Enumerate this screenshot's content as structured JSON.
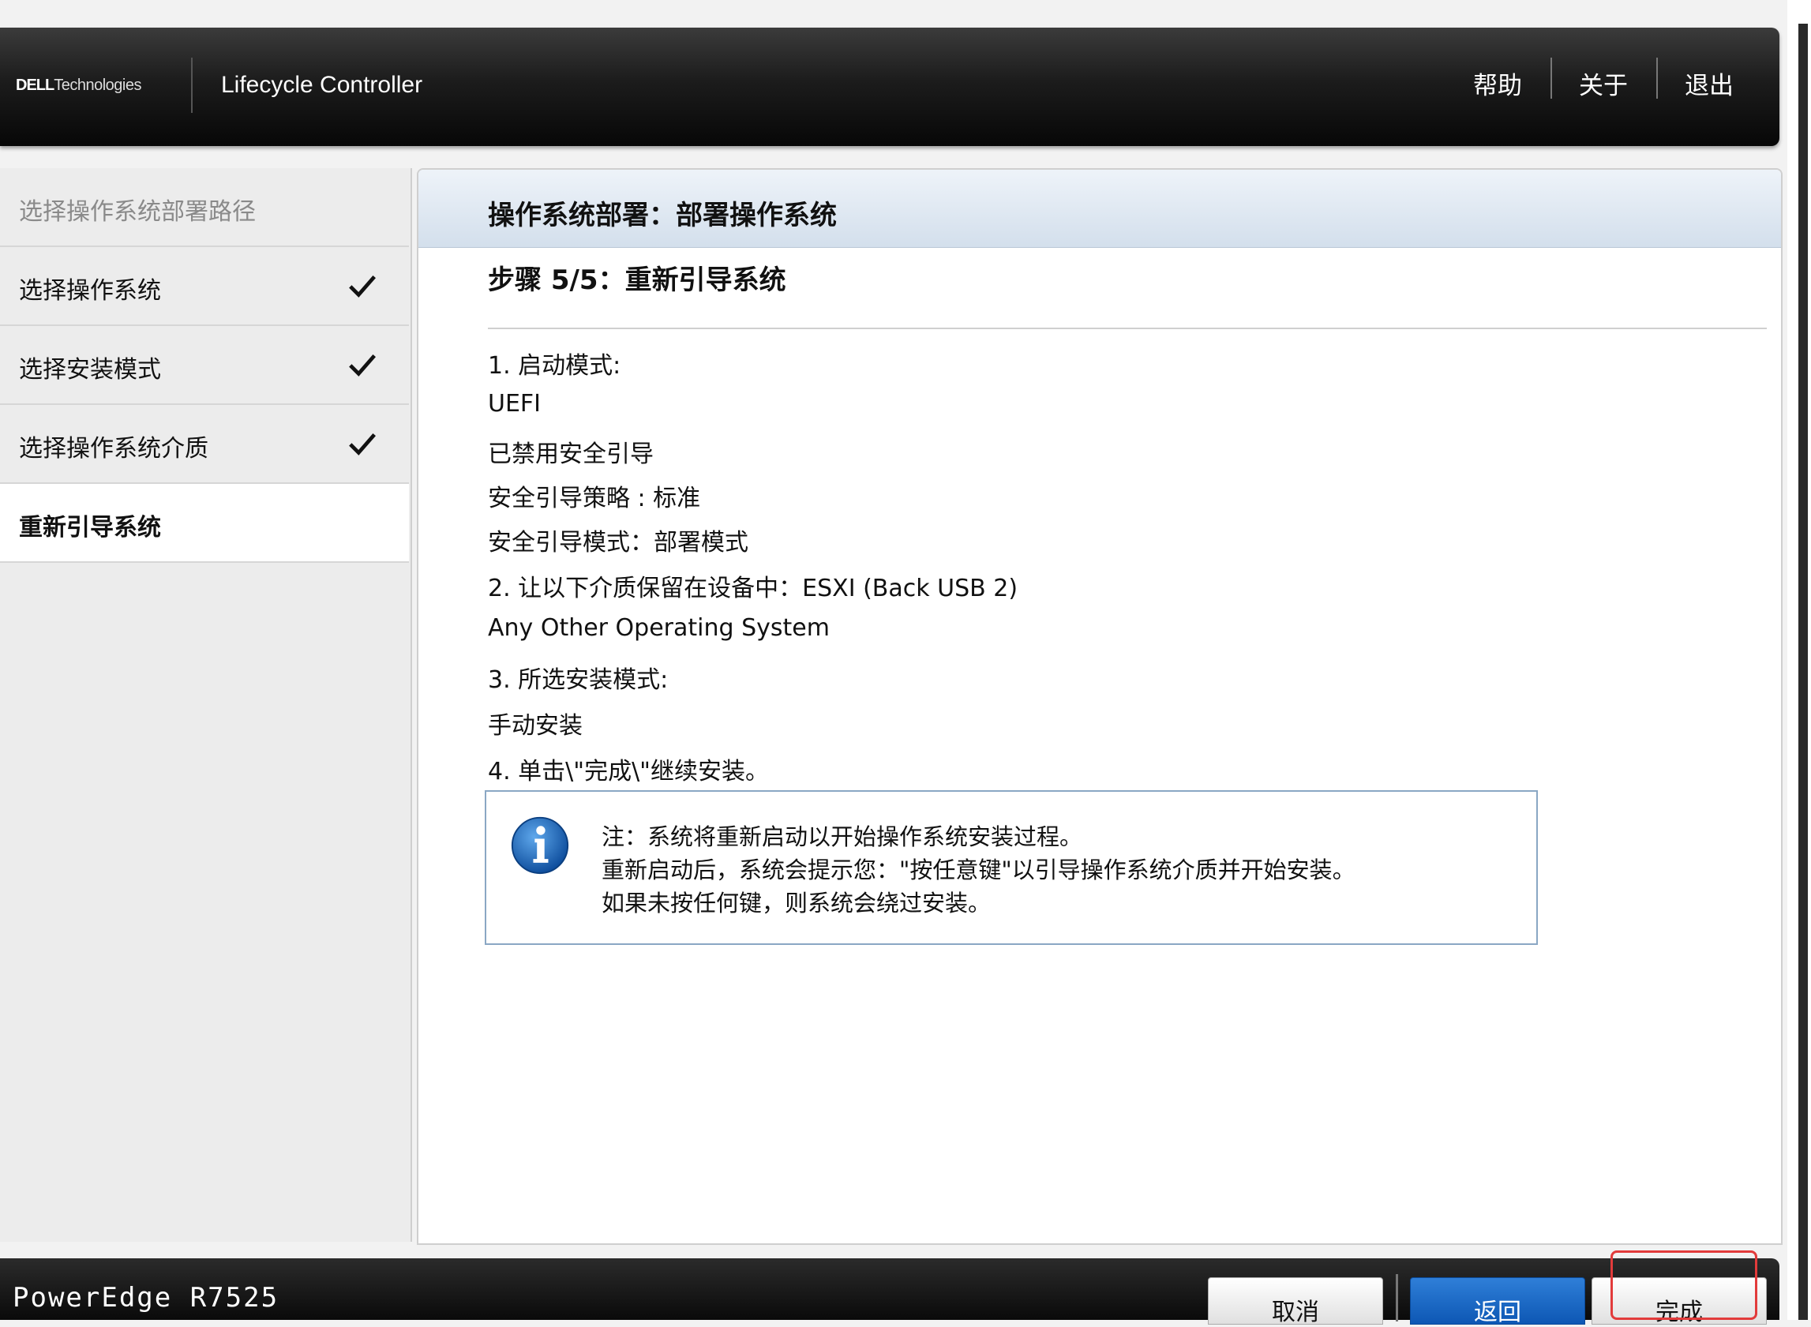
{
  "header": {
    "brand_dell": "DELL",
    "brand_tech": "Technologies",
    "product": "Lifecycle Controller",
    "links": {
      "help": "帮助",
      "about": "关于",
      "exit": "退出"
    }
  },
  "sidebar": {
    "items": [
      {
        "label": "选择操作系统部署路径",
        "state": "disabled"
      },
      {
        "label": "选择操作系统",
        "state": "done"
      },
      {
        "label": "选择安装模式",
        "state": "done"
      },
      {
        "label": "选择操作系统介质",
        "state": "done"
      },
      {
        "label": "重新引导系统",
        "state": "active"
      }
    ]
  },
  "main": {
    "title": "操作系统部署：部署操作系统",
    "step": "步骤 5/5：重新引导系统",
    "lines": [
      "1. 启动模式:",
      "UEFI",
      "已禁用安全引导",
      "安全引导策略 : 标准",
      "安全引导模式：部署模式",
      "2. 让以下介质保留在设备中：ESXI (Back USB 2)",
      "Any Other Operating System",
      "3.  所选安装模式:",
      "手动安装",
      "4. 单击\\\"完成\\\"继续安装。"
    ],
    "note": [
      "注：系统将重新启动以开始操作系统安装过程。",
      "重新启动后，系统会提示您：\"按任意键\"以引导操作系统介质并开始安装。",
      "如果未按任何键，则系统会绕过安装。"
    ]
  },
  "footer": {
    "model": "PowerEdge R7525",
    "buttons": {
      "cancel": "取消",
      "back": "返回",
      "finish": "完成"
    }
  },
  "colors": {
    "accent_blue": "#0d57b4",
    "highlight_red": "#e23b3b",
    "header_dark": "#1c1c1c"
  },
  "icons": {
    "check": "check-icon",
    "info": "info-icon"
  }
}
